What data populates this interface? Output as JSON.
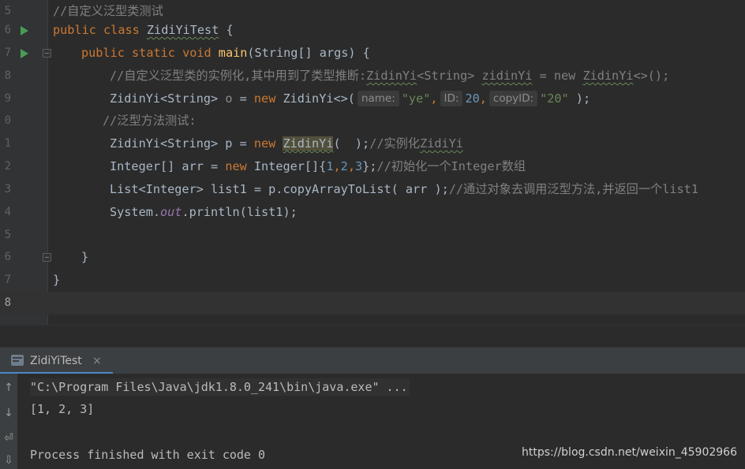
{
  "editor": {
    "line_numbers": [
      "5",
      "6",
      "7",
      "8",
      "9",
      "0",
      "1",
      "2",
      "3",
      "4",
      "5",
      "6",
      "7",
      "8"
    ],
    "l5": {
      "comment": "//自定义泛型类测试"
    },
    "l6": {
      "kw1": "public",
      "kw2": "class",
      "name": "ZidiYiTest",
      "rest": " {"
    },
    "l7": {
      "kw1": "public",
      "kw2": "static",
      "kw3": "void",
      "fn": "main",
      "rest": "(String[] args) {"
    },
    "l8": {
      "comment_a": "//自定义泛型类的实例化,其中用到了类型推断:",
      "comment_b": "ZidinYi",
      "comment_c": "<String> ",
      "comment_d": "zidinYi",
      "comment_e": " = new ",
      "comment_f": "ZidinYi",
      "comment_g": "<>();"
    },
    "l9": {
      "a": "ZidinYi<String> ",
      "var": "o",
      "b": " = ",
      "kw": "new",
      "c": " ZidinYi<>(",
      "hint1": "name:",
      "str1": "\"ye\"",
      "comma1": ",",
      "hint2": "ID:",
      "num1": "20",
      "comma2": ",",
      "hint3": "copyID:",
      "str2": "\"20\"",
      "end": " );"
    },
    "l10": {
      "comment": "//泛型方法测试:"
    },
    "l11": {
      "a": "ZidinYi<String> p = ",
      "kw": "new",
      "sp": " ",
      "cls": "ZidinYi",
      "b": "(  );",
      "comment": "//实例化",
      "comment_b": "ZidiYi"
    },
    "l12": {
      "a": "Integer[] arr = ",
      "kw": "new",
      "b": " Integer[]{",
      "n1": "1",
      "c1": ",",
      "n2": "2",
      "c2": ",",
      "n3": "3",
      "c": "};",
      "comment": "//初始化一个Integer数组"
    },
    "l13": {
      "a": "List<Integer> list1 = p.copyArrayToList( arr );",
      "comment": "//通过对象去调用泛型方法,并返回一个list1"
    },
    "l14": {
      "a": "System.",
      "field": "out",
      "b": ".println(list1);"
    },
    "l16": {
      "brace": "}"
    },
    "l17": {
      "brace": "}"
    }
  },
  "run_panel": {
    "tab_label": "ZidiYiTest",
    "tab_close": "×",
    "toolbar_icons": [
      "arrow-up-icon",
      "arrow-down-icon",
      "soft-wrap-icon",
      "scroll-to-end-icon"
    ],
    "toolbar_glyphs": [
      "↑",
      "↓",
      "⏎",
      "⇩"
    ],
    "command": "\"C:\\Program Files\\Java\\jdk1.8.0_241\\bin\\java.exe\" ...",
    "output": "[1, 2, 3]",
    "exit": "Process finished with exit code 0"
  },
  "watermark": "https://blog.csdn.net/weixin_45902966",
  "colors": {
    "keyword": "#cc7832",
    "comment": "#808080",
    "string": "#6a8759",
    "number": "#6897bb",
    "function": "#ffc66d",
    "background": "#2b2b2b"
  }
}
